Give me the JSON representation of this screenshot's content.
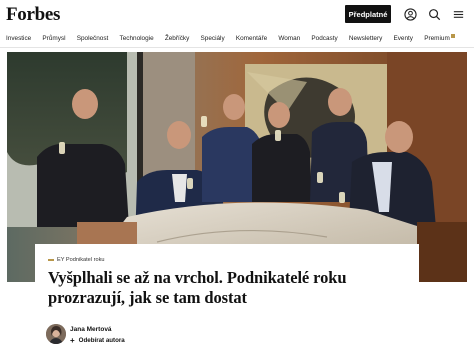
{
  "header": {
    "logo": "Forbes",
    "subscribe_label": "Předplatné",
    "icons": [
      "user-icon",
      "search-icon",
      "menu-icon"
    ]
  },
  "nav": {
    "items": [
      "Investice",
      "Průmysl",
      "Společnost",
      "Technologie",
      "Žebříčky",
      "Speciály",
      "Komentáře",
      "Woman",
      "Podcasty",
      "Newslettery",
      "Eventy",
      "Premium"
    ]
  },
  "article": {
    "kicker": "EY Podnikatel roku",
    "headline": "Vyšplhali se až na vrchol. Podnikatelé roku prozrazují, jak se tam dostat",
    "author": "Jana Mertová",
    "follow_label": "Odebírat autora"
  },
  "colors": {
    "brand": "#111111",
    "accent": "#b8974a"
  }
}
